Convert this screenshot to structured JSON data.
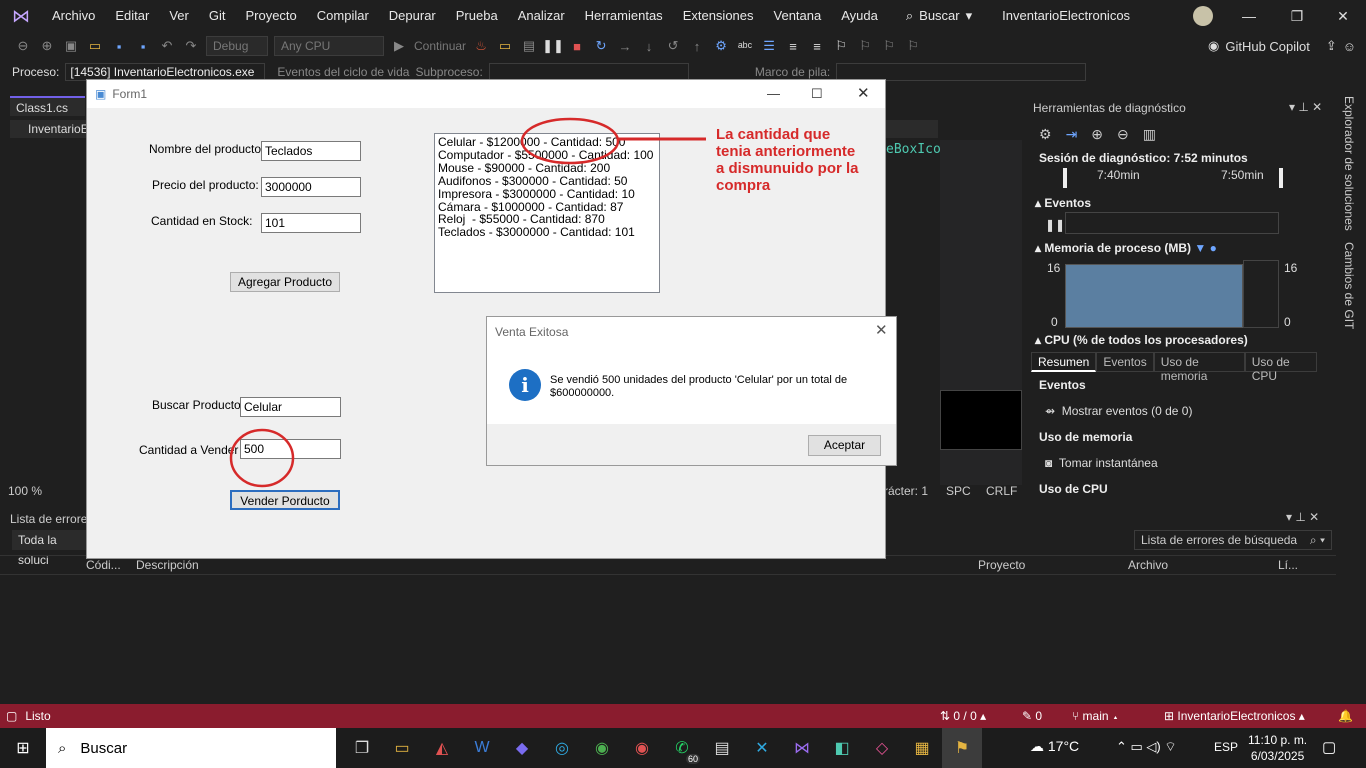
{
  "menu": {
    "items": [
      "Archivo",
      "Editar",
      "Ver",
      "Git",
      "Proyecto",
      "Compilar",
      "Depurar",
      "Prueba",
      "Analizar",
      "Herramientas",
      "Extensiones",
      "Ventana",
      "Ayuda"
    ],
    "search_label": "Buscar",
    "solution_name": "InventarioElectronicos"
  },
  "toolbar": {
    "config": "Debug",
    "platform": "Any CPU",
    "continue": "Continuar",
    "copilot": "GitHub Copilot"
  },
  "procbar": {
    "label": "Proceso:",
    "process": "[14536] InventarioElectronicos.exe",
    "lifecycle": "Eventos del ciclo de vida",
    "subprocess": "Subproceso:",
    "stackframe": "Marco de pila:"
  },
  "editor": {
    "tab": "Class1.cs",
    "tab2": "InventarioE",
    "zoom": "100 %",
    "code_fragment": "eBoxIcon",
    "status_char": "rácter: 1",
    "status_spc": "SPC",
    "status_crlf": "CRLF"
  },
  "diagnostics": {
    "title": "Herramientas de diagnóstico",
    "session": "Sesión de diagnóstico: 7:52 minutos",
    "time1": "7:40min",
    "time2": "7:50min",
    "events": "Eventos",
    "memory": "Memoria de proceso (MB)",
    "mem_top": "16",
    "mem_bottom": "0",
    "cpu": "CPU (% de todos los procesadores)",
    "tabs": [
      "Resumen",
      "Eventos",
      "Uso de memoria",
      "Uso de CPU"
    ],
    "sec_events": "Eventos",
    "show_events": "Mostrar eventos (0 de 0)",
    "sec_memory": "Uso de memoria",
    "snapshot": "Tomar instantánea",
    "sec_cpu": "Uso de CPU"
  },
  "side_tabs": [
    "Explorador de soluciones",
    "Cambios de GIT"
  ],
  "errors": {
    "title": "Lista de errores",
    "filter": "Toda la soluci",
    "search_placeholder": "Lista de errores de búsqueda",
    "cols": [
      "Códi...",
      "Descripción",
      "Proyecto",
      "Archivo",
      "Lí..."
    ]
  },
  "status": {
    "ready": "Listo",
    "sync": "0 / 0",
    "pending": "0",
    "branch": "main",
    "repo": "InventarioElectronicos"
  },
  "taskbar": {
    "search": "Buscar",
    "weather": "17°C",
    "lang": "ESP",
    "time": "11:10 p. m.",
    "date": "6/03/2025",
    "badge": "60"
  },
  "form1": {
    "title": "Form1",
    "name_label": "Nombre del producto:",
    "name_value": "Teclados",
    "price_label": "Precio del producto:",
    "price_value": "3000000",
    "stock_label": "Cantidad en Stock:",
    "stock_value": "101",
    "add_button": "Agregar Producto",
    "search_label": "Buscar Producto:",
    "search_value": "Celular",
    "qty_label": "Cantidad a Vender",
    "qty_value": "500",
    "sell_button": "Vender Porducto",
    "list": [
      "Celular - $1200000 - Cantidad: 500",
      "Computador - $5500000 - Cantidad: 100",
      "Mouse - $90000 - Cantidad: 200",
      "Audifonos - $300000 - Cantidad: 50",
      "Impresora - $3000000 - Cantidad: 10",
      "Cámara - $1000000 - Cantidad: 87",
      "Reloj  - $55000 - Cantidad: 870",
      "Teclados - $3000000 - Cantidad: 101"
    ]
  },
  "annotation": {
    "text": "La cantidad que tenia anteriormente a dismunuido por la compra",
    "color": "#d62a2a"
  },
  "msgbox": {
    "title": "Venta Exitosa",
    "message": "Se vendió 500 unidades del producto 'Celular' por un total de $600000000.",
    "ok": "Aceptar"
  }
}
